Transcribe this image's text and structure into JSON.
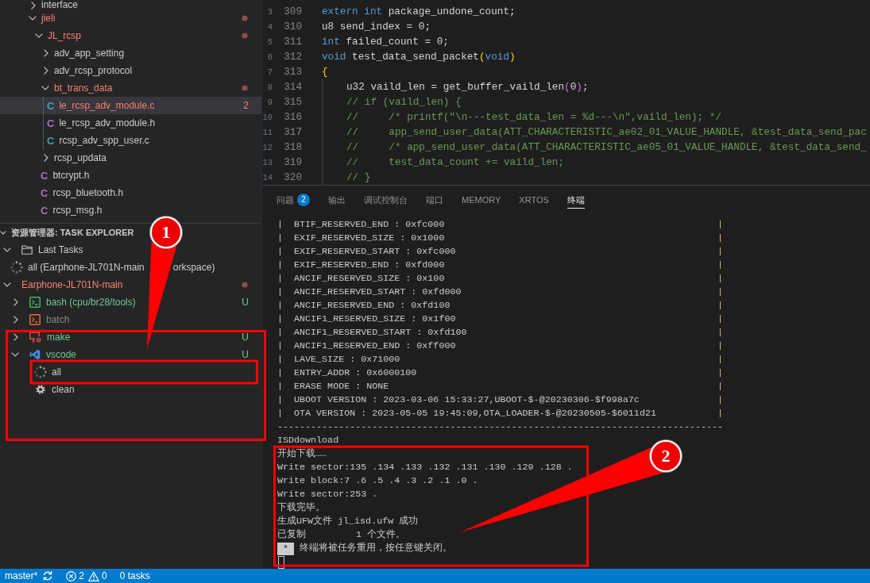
{
  "explorer": {
    "tree": [
      {
        "kind": "folder",
        "label": "interface",
        "expanded": false,
        "error": false,
        "selected": false
      },
      {
        "kind": "folder",
        "label": "jieli",
        "expanded": true,
        "error": true,
        "selected": false,
        "children": [
          {
            "kind": "folder",
            "label": "JL_rcsp",
            "expanded": true,
            "error": true,
            "selected": false,
            "children": [
              {
                "kind": "folder",
                "label": "adv_app_setting",
                "expanded": false,
                "error": false,
                "selected": false
              },
              {
                "kind": "folder",
                "label": "adv_rcsp_protocol",
                "expanded": false,
                "error": false,
                "selected": false
              },
              {
                "kind": "folder",
                "label": "bt_trans_data",
                "expanded": true,
                "error": true,
                "selected": false,
                "children": [
                  {
                    "kind": "source",
                    "icon_letter": "C",
                    "label": "le_rcsp_adv_module.c",
                    "error": true,
                    "problems": "2",
                    "selected": true
                  },
                  {
                    "kind": "header",
                    "icon_letter": "C",
                    "label": "le_rcsp_adv_module.h",
                    "error": false,
                    "selected": false
                  },
                  {
                    "kind": "source",
                    "icon_letter": "C",
                    "label": "rcsp_adv_spp_user.c",
                    "error": false,
                    "selected": false
                  }
                ]
              },
              {
                "kind": "folder",
                "label": "rcsp_updata",
                "expanded": false,
                "error": false,
                "selected": false
              },
              {
                "kind": "header",
                "icon_letter": "C",
                "label": "btcrypt.h",
                "error": false,
                "selected": false
              },
              {
                "kind": "header",
                "icon_letter": "C",
                "label": "rcsp_bluetooth.h",
                "error": false,
                "selected": false
              },
              {
                "kind": "header",
                "icon_letter": "C",
                "label": "rcsp_msg.h",
                "error": false,
                "selected": false
              }
            ]
          }
        ]
      }
    ]
  },
  "task_explorer": {
    "title": "资源管理器: TASK EXPLORER",
    "expanded": true,
    "tree": [
      {
        "kind": "group",
        "label": "Last Tasks",
        "expanded": true,
        "selected": false,
        "children": [
          {
            "kind": "task",
            "label": "all (Earphone-JL701N-main",
            "label_after_pointer": "orkspace)",
            "running": true,
            "selected": false
          }
        ]
      },
      {
        "kind": "workspace",
        "label": "Earphone-JL701N-main",
        "expanded": true,
        "error": true,
        "selected": false,
        "children": [
          {
            "kind": "shell",
            "label": "bash (cpu/br28/tools)",
            "expanded": false,
            "git_status": "U",
            "dimmed": false,
            "selected": false
          },
          {
            "kind": "batch",
            "label": "batch",
            "expanded": false,
            "dimmed": true,
            "selected": false
          },
          {
            "kind": "make",
            "label": "make",
            "expanded": false,
            "git_status": "U",
            "dimmed": false,
            "selected": false
          },
          {
            "kind": "vscode",
            "label": "vscode",
            "expanded": true,
            "git_status": "U",
            "dimmed": false,
            "selected": false,
            "children": [
              {
                "kind": "task",
                "label": "all",
                "running": true,
                "selected": false
              },
              {
                "kind": "task",
                "label": "clean",
                "running": false,
                "selected": false
              }
            ]
          }
        ]
      }
    ]
  },
  "editor": {
    "lines": [
      {
        "relative": "3",
        "number": "309",
        "tokens": [
          {
            "kind": "keyword",
            "text": "extern int"
          },
          {
            "kind": "plain",
            "text": " package_undone_count;"
          }
        ]
      },
      {
        "relative": "4",
        "number": "310",
        "tokens": [
          {
            "kind": "plain",
            "text": "u8 send_index = 0;"
          }
        ]
      },
      {
        "relative": "5",
        "number": "311",
        "tokens": [
          {
            "kind": "keyword",
            "text": "int"
          },
          {
            "kind": "plain",
            "text": " failed_count = 0;"
          }
        ]
      },
      {
        "relative": "6",
        "number": "312",
        "tokens": [
          {
            "kind": "keyword",
            "text": "void"
          },
          {
            "kind": "plain",
            "text": " test_data_send_packet"
          },
          {
            "kind": "bracket",
            "text": "("
          },
          {
            "kind": "keyword",
            "text": "void"
          },
          {
            "kind": "bracket",
            "text": ")"
          }
        ]
      },
      {
        "relative": "7",
        "number": "313",
        "tokens": [
          {
            "kind": "bracket",
            "text": "{"
          }
        ],
        "children": [
          {
            "relative": "8",
            "number": "314",
            "tokens": [
              {
                "kind": "plain",
                "text": "u32 vaild_len = get_buffer_vaild_len"
              },
              {
                "kind": "bracket2",
                "text": "("
              },
              {
                "kind": "plain",
                "text": "0"
              },
              {
                "kind": "bracket2",
                "text": ")"
              },
              {
                "kind": "plain",
                "text": ";"
              }
            ]
          },
          {
            "relative": "9",
            "number": "315",
            "tokens": [
              {
                "kind": "comment",
                "text": "// if (vaild_len) {"
              }
            ]
          },
          {
            "relative": "10",
            "number": "316",
            "tokens": [
              {
                "kind": "comment",
                "text": "//     /* printf(\"\\n---test_data_len = %d---\\n\",vaild_len); */"
              }
            ]
          },
          {
            "relative": "11",
            "number": "317",
            "tokens": [
              {
                "kind": "comment",
                "text": "//     app_send_user_data(ATT_CHARACTERISTIC_ae02_01_VALUE_HANDLE, &test_data_send_pac"
              }
            ]
          },
          {
            "relative": "12",
            "number": "318",
            "tokens": [
              {
                "kind": "comment",
                "text": "//     /* app_send_user_data(ATT_CHARACTERISTIC_ae05_01_VALUE_HANDLE, &test_data_send_"
              }
            ]
          },
          {
            "relative": "13",
            "number": "319",
            "tokens": [
              {
                "kind": "comment",
                "text": "//     test_data_count += vaild_len;"
              }
            ]
          },
          {
            "relative": "14",
            "number": "320",
            "tokens": [
              {
                "kind": "comment",
                "text": "// }"
              }
            ]
          }
        ]
      }
    ]
  },
  "panel": {
    "tabs": [
      {
        "label": "问题",
        "badge": "2",
        "selected": false
      },
      {
        "label": "输出",
        "selected": false
      },
      {
        "label": "调试控制台",
        "selected": false
      },
      {
        "label": "端口",
        "selected": false
      },
      {
        "label": "MEMORY",
        "selected": false
      },
      {
        "label": "XRTOS",
        "selected": false
      },
      {
        "label": "终端",
        "selected": true
      }
    ],
    "terminal": {
      "box_rows": [
        {
          "left": "|",
          "text": "BTIF_RESERVED_END : 0xfc000",
          "right": "|"
        },
        {
          "left": "|",
          "text": "EXIF_RESERVED_SIZE : 0x1000",
          "right": "|"
        },
        {
          "left": "|",
          "text": "EXIF_RESERVED_START : 0xfc000",
          "right": "|"
        },
        {
          "left": "|",
          "text": "EXIF_RESERVED_END : 0xfd000",
          "right": "|"
        },
        {
          "left": "|",
          "text": "ANCIF_RESERVED_SIZE : 0x100",
          "right": "|"
        },
        {
          "left": "|",
          "text": "ANCIF_RESERVED_START : 0xfd000",
          "right": "|"
        },
        {
          "left": "|",
          "text": "ANCIF_RESERVED_END : 0xfd100",
          "right": "|"
        },
        {
          "left": "|",
          "text": "ANCIF1_RESERVED_SIZE : 0x1f00",
          "right": "|"
        },
        {
          "left": "|",
          "text": "ANCIF1_RESERVED_START : 0xfd100",
          "right": "|"
        },
        {
          "left": "|",
          "text": "ANCIF1_RESERVED_END : 0xff000",
          "right": "|"
        },
        {
          "left": "|",
          "text": "LAVE_SIZE : 0x71000",
          "right": "|"
        },
        {
          "left": "|",
          "text": "ENTRY_ADDR : 0x6000100",
          "right": "|"
        },
        {
          "left": "|",
          "text": "ERASE MODE : NONE",
          "right": "|"
        },
        {
          "left": "|",
          "text": "UBOOT VERSION : 2023-03-06 15:33:27,UBOOT-$-@20230306-$f998a7c",
          "right": "|"
        },
        {
          "left": "|",
          "text": "OTA VERSION : 2023-05-05 19:45:09,OTA_LOADER-$-@20230505-$6011d21",
          "right": "|"
        }
      ],
      "box_bottom": "--------------------------------------------------------------------------------",
      "lines": [
        {
          "kind": "plain",
          "text": "ISDdownload"
        },
        {
          "kind": "plain",
          "text": "开始下载……"
        },
        {
          "kind": "plain",
          "text": "Write sector:135 .134 .133 .132 .131 .130 .129 .128 ."
        },
        {
          "kind": "plain",
          "text": "Write block:7 .6 .5 .4 .3 .2 .1 .0 ."
        },
        {
          "kind": "plain",
          "text": "Write sector:253 ."
        },
        {
          "kind": "plain",
          "text": "下载完毕。"
        },
        {
          "kind": "plain",
          "text": "生成UFW文件 jl_isd.ufw 成功"
        },
        {
          "kind": "plain",
          "text": "已复制         1 个文件。"
        },
        {
          "kind": "notice",
          "marker": "*",
          "text": "终端将被任务重用，按任意键关闭。"
        }
      ]
    }
  },
  "status_bar": {
    "branch": "master*",
    "errors": "2",
    "warnings": "0",
    "tasks": "0 tasks"
  },
  "callouts": [
    {
      "label": "1"
    },
    {
      "label": "2"
    }
  ]
}
